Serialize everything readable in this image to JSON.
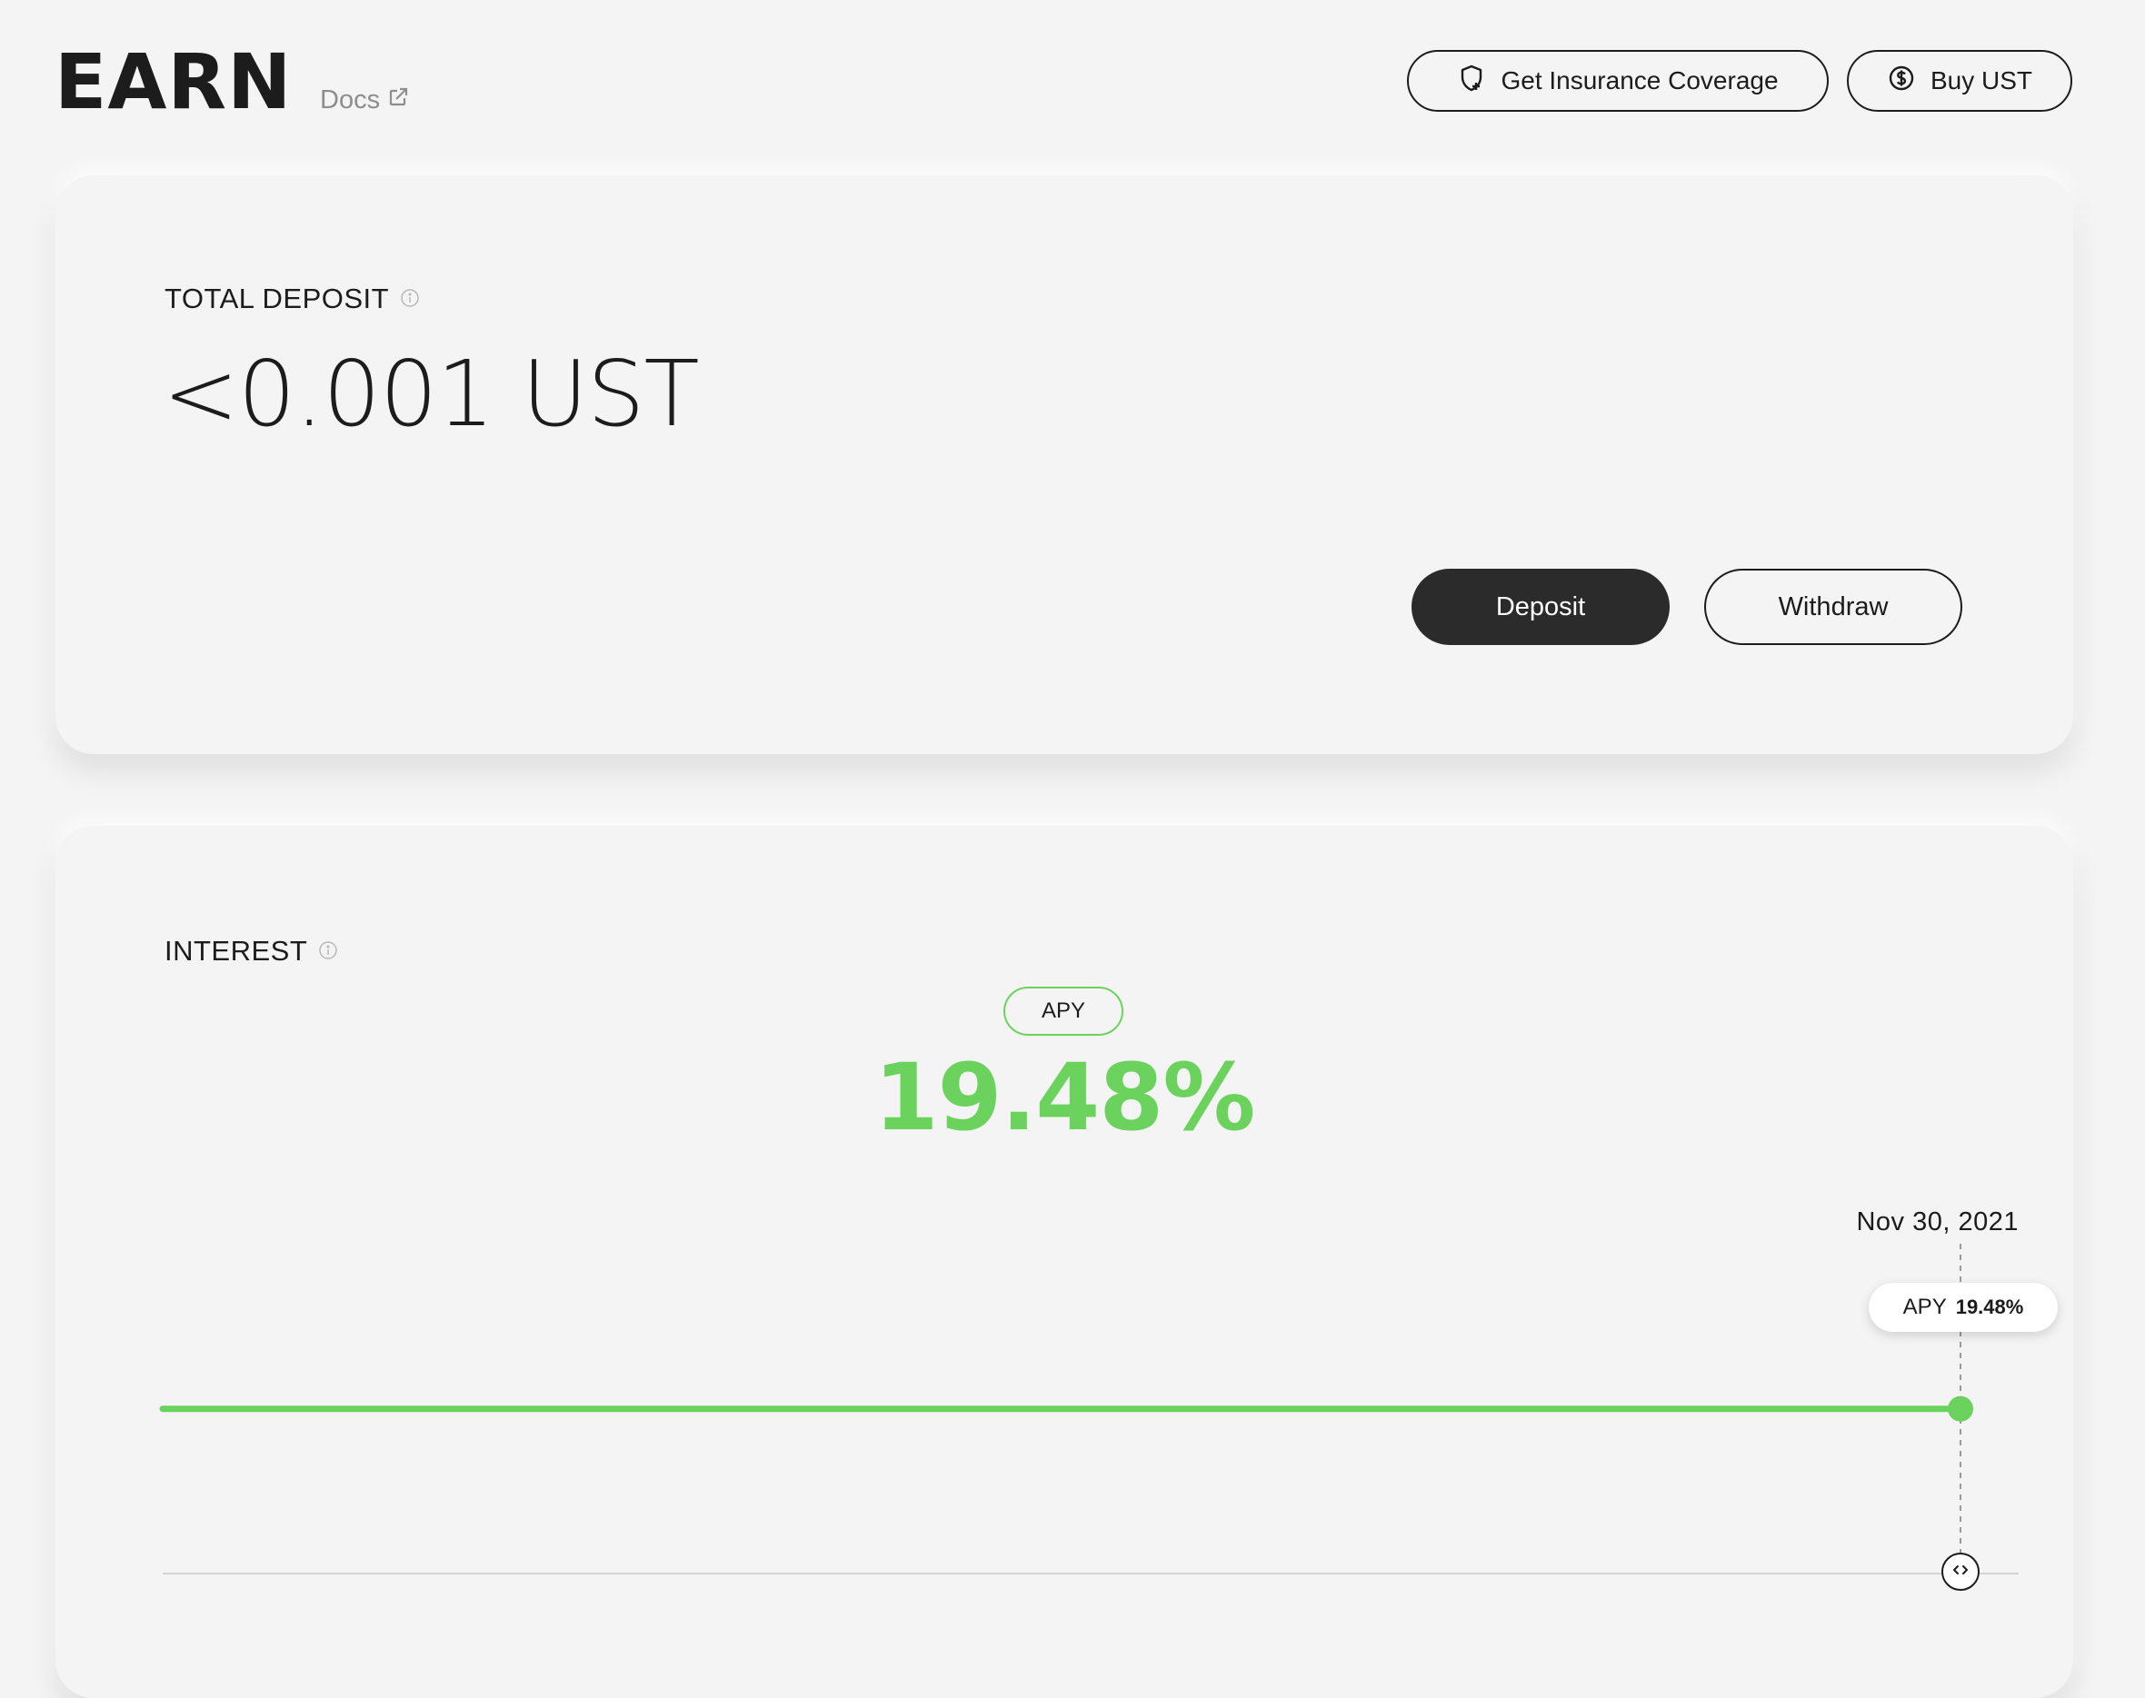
{
  "header": {
    "title": "EARN",
    "docs_label": "Docs",
    "insurance_label": "Get Insurance Coverage",
    "buy_label": "Buy UST"
  },
  "deposit_card": {
    "label": "TOTAL DEPOSIT",
    "amount": "<0.001 UST",
    "deposit_label": "Deposit",
    "withdraw_label": "Withdraw"
  },
  "interest_card": {
    "label": "INTEREST",
    "apy_pill": "APY",
    "apy_value": "19.48%",
    "chart_date": "Nov 30, 2021",
    "tooltip_label": "APY",
    "tooltip_value": "19.48%"
  },
  "icons": {
    "docs": "external-link-icon",
    "insurance": "shield-plus-icon",
    "buy": "dollar-circle-icon",
    "info": "info-icon",
    "handle": "chevrons-left-right-icon"
  },
  "colors": {
    "accent_green": "#6bd35d",
    "text": "#1c1c1c",
    "background": "#f4f4f4",
    "primary_button": "#2b2b2b"
  },
  "chart_data": {
    "type": "line",
    "series": [
      {
        "values": [
          19.48,
          19.48,
          19.48,
          19.48,
          19.48,
          19.48,
          19.48,
          19.48,
          19.48,
          19.48,
          19.48
        ]
      }
    ],
    "selected_point": {
      "x": "Nov 30, 2021",
      "y": 19.48
    },
    "ylim": [
      0,
      39
    ],
    "grid": false
  }
}
